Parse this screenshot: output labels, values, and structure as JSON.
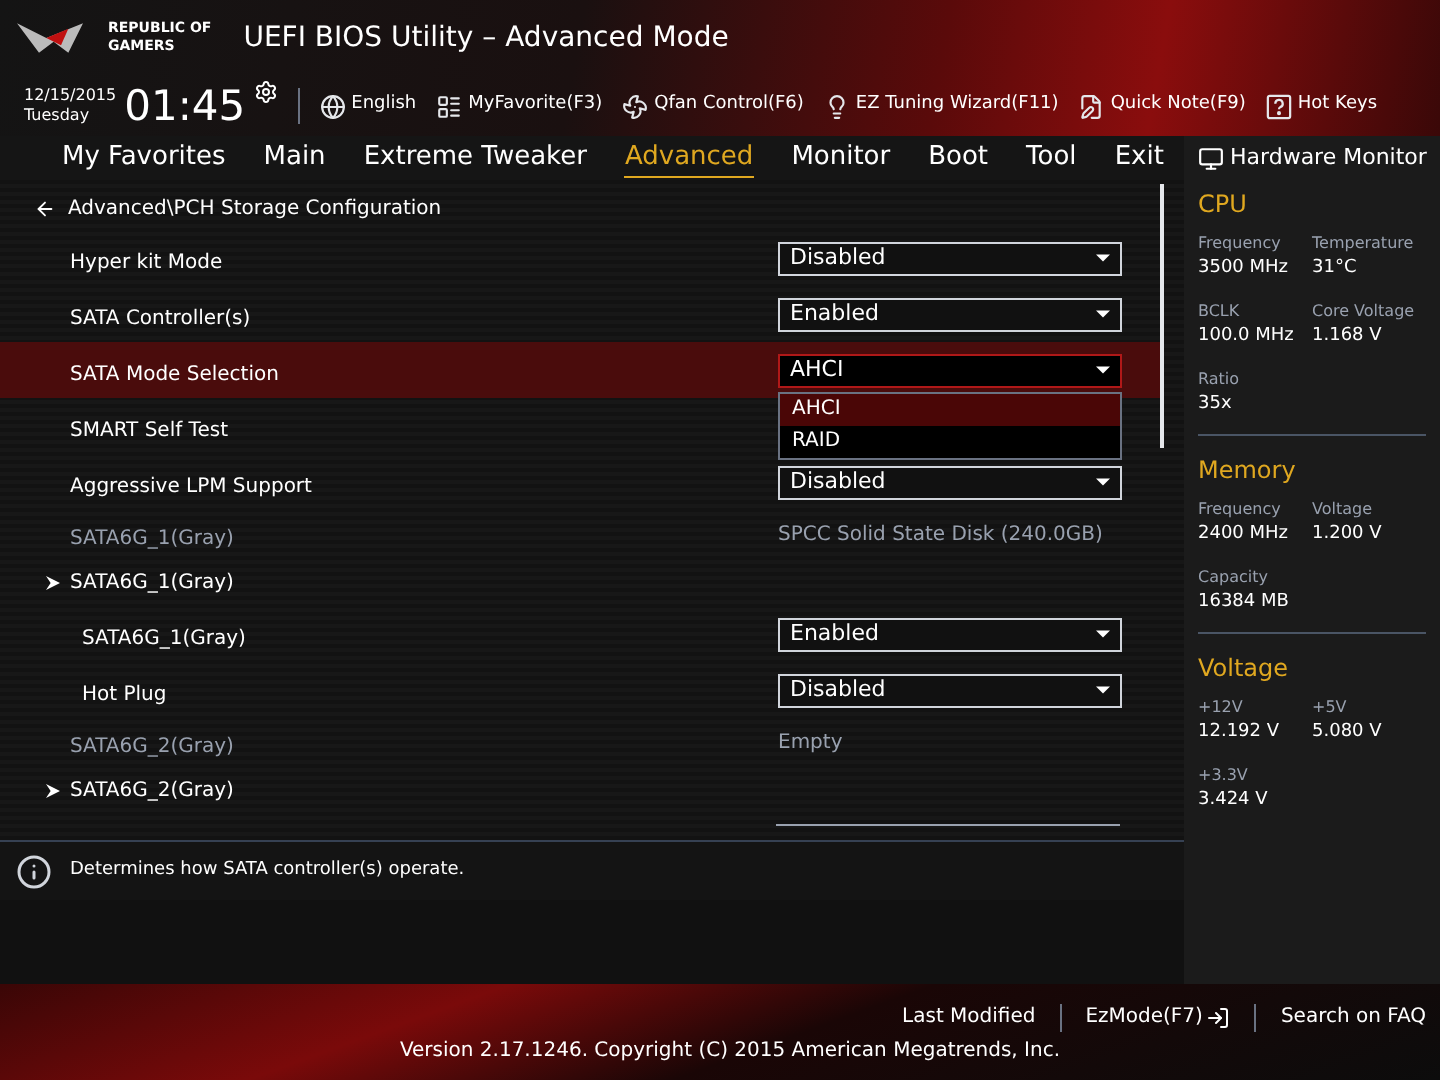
{
  "header": {
    "brand_line1": "REPUBLIC OF",
    "brand_line2": "GAMERS",
    "title": "UEFI BIOS Utility – Advanced Mode"
  },
  "clock": {
    "date": "12/15/2015",
    "day": "Tuesday",
    "time": "01:45"
  },
  "toolbar": [
    {
      "kind": "language",
      "label": "English"
    },
    {
      "kind": "favorite",
      "label": "MyFavorite(F3)"
    },
    {
      "kind": "fan",
      "label": "Qfan Control(F6)"
    },
    {
      "kind": "wizard",
      "label": "EZ Tuning Wizard(F11)"
    },
    {
      "kind": "note",
      "label": "Quick Note(F9)"
    },
    {
      "kind": "help",
      "label": "Hot Keys"
    }
  ],
  "tabs": [
    {
      "label": "My Favorites",
      "selected": false
    },
    {
      "label": "Main",
      "selected": false
    },
    {
      "label": "Extreme Tweaker",
      "selected": false
    },
    {
      "label": "Advanced",
      "selected": true
    },
    {
      "label": "Monitor",
      "selected": false
    },
    {
      "label": "Boot",
      "selected": false
    },
    {
      "label": "Tool",
      "selected": false
    },
    {
      "label": "Exit",
      "selected": false
    }
  ],
  "breadcrumb": "Advanced\\PCH Storage Configuration",
  "settings": [
    {
      "kind": "select",
      "label": "Hyper kit Mode",
      "value": "Disabled",
      "selected": false
    },
    {
      "kind": "select",
      "label": "SATA Controller(s)",
      "value": "Enabled",
      "selected": false
    },
    {
      "kind": "select",
      "label": "SATA Mode Selection",
      "value": "AHCI",
      "selected": true,
      "options": [
        {
          "label": "AHCI",
          "selected": true
        },
        {
          "label": "RAID",
          "selected": false
        }
      ]
    },
    {
      "kind": "select",
      "label": "SMART Self Test",
      "selected": false
    },
    {
      "kind": "select",
      "label": "Aggressive LPM Support",
      "value": "Disabled",
      "selected": false
    },
    {
      "kind": "info",
      "label": "SATA6G_1(Gray)",
      "value": "SPCC Solid State Disk (240.0GB)",
      "selected": false
    },
    {
      "kind": "submenu",
      "label": "SATA6G_1(Gray)",
      "selected": false
    },
    {
      "kind": "subselect",
      "label": "SATA6G_1(Gray)",
      "value": "Enabled",
      "selected": false
    },
    {
      "kind": "subselect",
      "label": "Hot Plug",
      "value": "Disabled",
      "selected": false
    },
    {
      "kind": "info",
      "label": "SATA6G_2(Gray)",
      "value": "Empty",
      "selected": false
    },
    {
      "kind": "submenu",
      "label": "SATA6G_2(Gray)",
      "selected": false
    }
  ],
  "help_text": "Determines how SATA controller(s) operate.",
  "hardware_monitor": {
    "title": "Hardware Monitor",
    "sections": [
      {
        "title": "CPU",
        "items": [
          {
            "label": "Frequency",
            "value": "3500 MHz"
          },
          {
            "label": "Temperature",
            "value": "31°C"
          },
          {
            "label": "BCLK",
            "value": "100.0 MHz"
          },
          {
            "label": "Core Voltage",
            "value": "1.168 V"
          },
          {
            "label": "Ratio",
            "value": "35x"
          }
        ]
      },
      {
        "title": "Memory",
        "items": [
          {
            "label": "Frequency",
            "value": "2400 MHz"
          },
          {
            "label": "Voltage",
            "value": "1.200 V"
          },
          {
            "label": "Capacity",
            "value": "16384 MB"
          }
        ]
      },
      {
        "title": "Voltage",
        "items": [
          {
            "label": "+12V",
            "value": "12.192 V"
          },
          {
            "label": "+5V",
            "value": "5.080 V"
          },
          {
            "label": "+3.3V",
            "value": "3.424 V"
          }
        ]
      }
    ]
  },
  "footer": {
    "links": [
      {
        "kind": "text",
        "label": "Last Modified"
      },
      {
        "kind": "ezmode",
        "label": "EzMode(F7)"
      },
      {
        "kind": "text",
        "label": "Search on FAQ"
      }
    ],
    "version": "Version 2.17.1246. Copyright (C) 2015 American Megatrends, Inc."
  }
}
